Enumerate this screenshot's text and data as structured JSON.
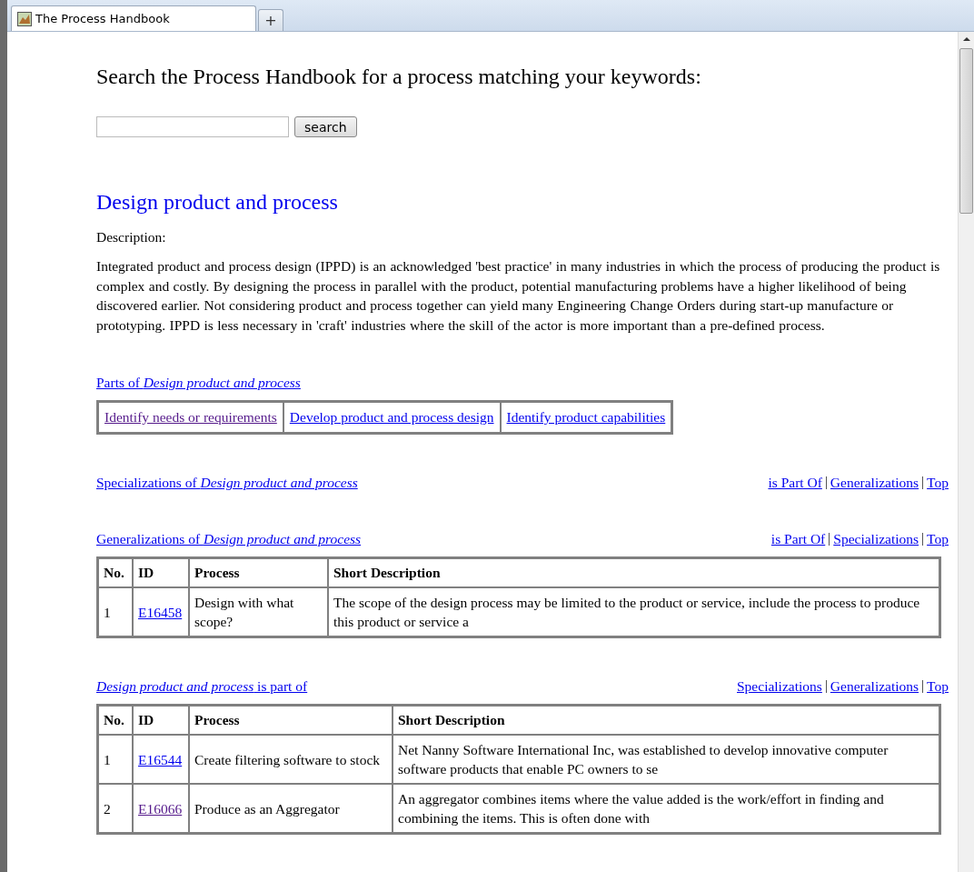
{
  "browser": {
    "tab_title": "The Process Handbook",
    "new_tab": "+"
  },
  "search": {
    "heading": "Search the Process Handbook for a process matching your keywords:",
    "button": "search"
  },
  "process": {
    "title": "Design product and process",
    "description_label": "Description:",
    "description": "Integrated product and process design (IPPD) is an acknowledged 'best practice' in many industries in which the process of producing the product is complex and costly. By designing the process in parallel with the product, potential manufacturing problems have a higher likelihood of being discovered earlier. Not considering product and process together can yield many Engineering Change Orders during start-up manufacture or prototyping. IPPD is less necessary in 'craft' industries where the skill of the actor is more important than a pre-defined process."
  },
  "sections": [
    {
      "kind": "parts",
      "heading": "Parts of *Design product and process*",
      "parts": [
        {
          "label": "Identify needs or requirements",
          "visited": true
        },
        {
          "label": "Develop product and process design",
          "visited": false
        },
        {
          "label": "Identify product capabilities",
          "visited": false
        }
      ]
    },
    {
      "kind": "empty",
      "heading": "Specializations of *Design product and process*",
      "nav_links": [
        "is Part Of",
        "Generalizations",
        "Top"
      ]
    },
    {
      "kind": "table",
      "heading": "Generalizations of *Design product and process*",
      "nav_links": [
        "is Part Of",
        "Specializations",
        "Top"
      ],
      "columns": [
        "No.",
        "ID",
        "Process",
        "Short Description"
      ],
      "rows": [
        {
          "no": "1",
          "id": "E16458",
          "visited": false,
          "process": "Design with what scope?",
          "description": "The scope of the design process may be limited to the product or service, include the process to produce this product or service a"
        }
      ]
    },
    {
      "kind": "table",
      "heading": "*Design product and process* is part of",
      "nav_links": [
        "Specializations",
        "Generalizations",
        "Top"
      ],
      "columns": [
        "No.",
        "ID",
        "Process",
        "Short Description"
      ],
      "rows": [
        {
          "no": "1",
          "id": "E16544",
          "visited": false,
          "process": "Create filtering software to stock",
          "description": "Net Nanny Software International Inc, was established to develop innovative computer software products that enable PC owners to se"
        },
        {
          "no": "2",
          "id": "E16066",
          "visited": true,
          "process": "Produce as an Aggregator",
          "description": "An aggregator combines items where the value added is the work/effort in finding and combining the items. This is often done with"
        }
      ]
    }
  ]
}
